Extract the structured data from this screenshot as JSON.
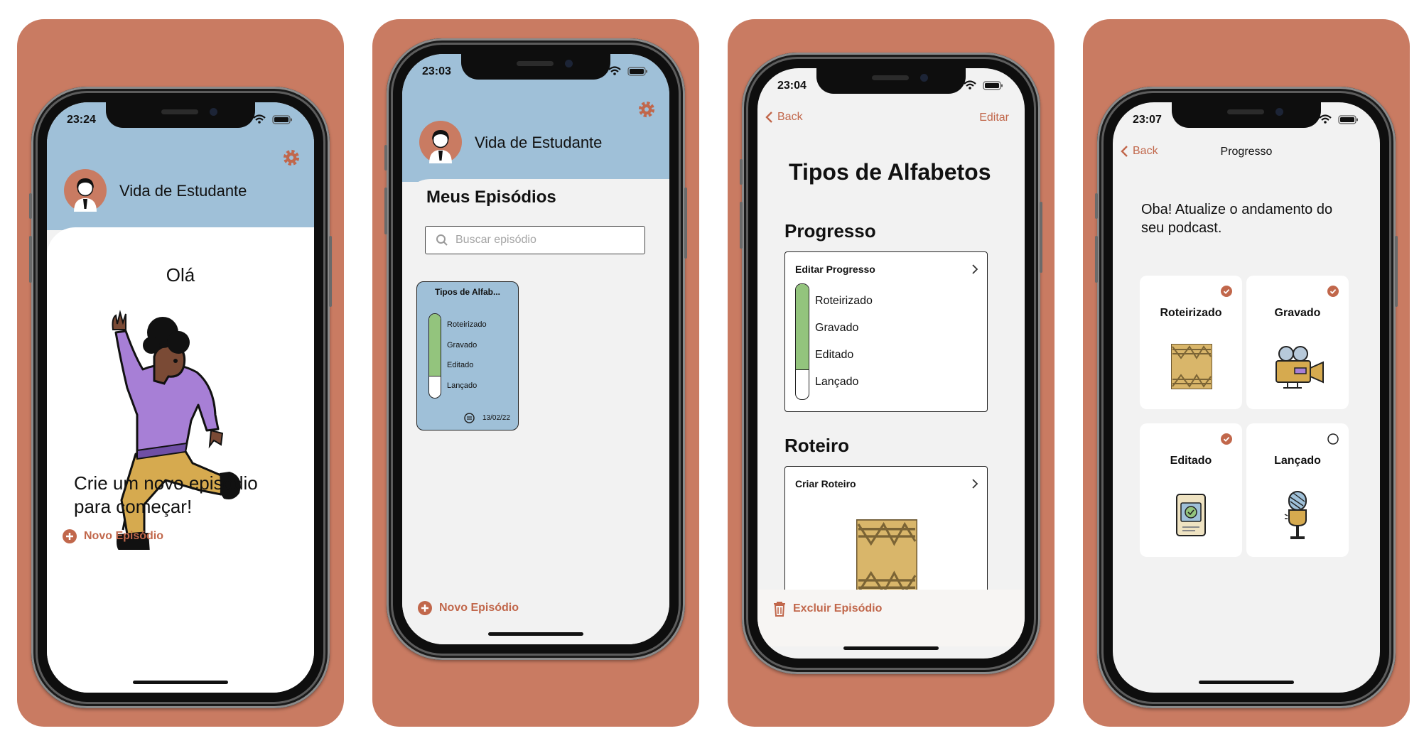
{
  "colors": {
    "background": "#c97b62",
    "header_blue": "#9fc0d8",
    "accent": "#c1674b",
    "progress_green": "#93c47d"
  },
  "screen1": {
    "time": "23:24",
    "header_title": "Vida de Estudante",
    "greeting": "Olá",
    "prompt_line1": "Crie um novo episódio",
    "prompt_line2": "para começar!",
    "new_episode": "Novo Episódio",
    "settings_icon": "gear-icon"
  },
  "screen2": {
    "time": "23:03",
    "header_title": "Vida de Estudante",
    "section_title": "Meus Episódios",
    "search_placeholder": "Buscar episódio",
    "episode": {
      "title": "Tipos de Alfab...",
      "steps": [
        "Roteirizado",
        "Gravado",
        "Editado",
        "Lançado"
      ],
      "completed": 3,
      "date": "13/02/22"
    },
    "new_episode": "Novo Episódio"
  },
  "screen3": {
    "time": "23:04",
    "back": "Back",
    "edit": "Editar",
    "title": "Tipos de Alfabetos",
    "progress_heading": "Progresso",
    "edit_progress": "Editar Progresso",
    "steps": [
      "Roteirizado",
      "Gravado",
      "Editado",
      "Lançado"
    ],
    "completed": 3,
    "script_heading": "Roteiro",
    "create_script": "Criar Roteiro",
    "delete_episode": "Excluir Episódio"
  },
  "screen4": {
    "time": "23:07",
    "back": "Back",
    "nav_title": "Progresso",
    "message_line1": "Oba! Atualize o andamento do",
    "message_line2": "seu podcast.",
    "cards": [
      {
        "label": "Roteirizado",
        "done": true,
        "icon": "script-paper-icon"
      },
      {
        "label": "Gravado",
        "done": true,
        "icon": "video-camera-icon"
      },
      {
        "label": "Editado",
        "done": true,
        "icon": "edit-tablet-icon"
      },
      {
        "label": "Lançado",
        "done": false,
        "icon": "microphone-icon"
      }
    ]
  }
}
